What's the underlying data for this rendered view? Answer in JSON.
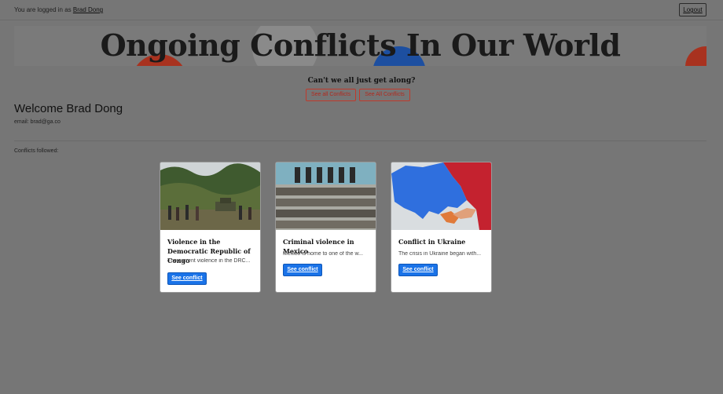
{
  "header": {
    "login_prefix": "You are logged in as ",
    "username": "Brad Dong",
    "logout_label": "Logout"
  },
  "banner": {
    "title": "Ongoing Conflicts In Our World"
  },
  "hero": {
    "tagline": "Can't we all just get along?",
    "buttons": [
      "See all Conflicts",
      "See All Conflicts"
    ]
  },
  "profile": {
    "welcome": "Welcome Brad Dong",
    "email_line": "email: brad@ga.co",
    "followed_label": "Conflicts followed:"
  },
  "cards": [
    {
      "title": "Violence in the Democratic Republic of Congo",
      "excerpt": "The current violence in the DRC...",
      "button": "See conflict"
    },
    {
      "title": "Criminal violence in Mexico",
      "excerpt": "Mexico is home to one of the w...",
      "button": "See conflict"
    },
    {
      "title": "Conflict in Ukraine",
      "excerpt": "The crisis in Ukraine began with...",
      "button": "See conflict"
    }
  ]
}
